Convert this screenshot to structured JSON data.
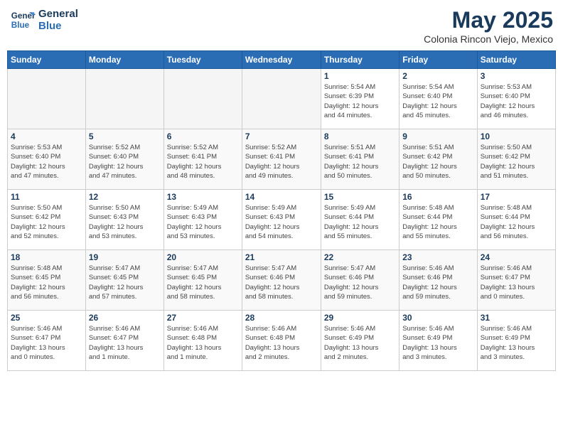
{
  "header": {
    "logo_line1": "General",
    "logo_line2": "Blue",
    "month_year": "May 2025",
    "location": "Colonia Rincon Viejo, Mexico"
  },
  "days_of_week": [
    "Sunday",
    "Monday",
    "Tuesday",
    "Wednesday",
    "Thursday",
    "Friday",
    "Saturday"
  ],
  "weeks": [
    [
      {
        "day": "",
        "info": ""
      },
      {
        "day": "",
        "info": ""
      },
      {
        "day": "",
        "info": ""
      },
      {
        "day": "",
        "info": ""
      },
      {
        "day": "1",
        "info": "Sunrise: 5:54 AM\nSunset: 6:39 PM\nDaylight: 12 hours\nand 44 minutes."
      },
      {
        "day": "2",
        "info": "Sunrise: 5:54 AM\nSunset: 6:40 PM\nDaylight: 12 hours\nand 45 minutes."
      },
      {
        "day": "3",
        "info": "Sunrise: 5:53 AM\nSunset: 6:40 PM\nDaylight: 12 hours\nand 46 minutes."
      }
    ],
    [
      {
        "day": "4",
        "info": "Sunrise: 5:53 AM\nSunset: 6:40 PM\nDaylight: 12 hours\nand 47 minutes."
      },
      {
        "day": "5",
        "info": "Sunrise: 5:52 AM\nSunset: 6:40 PM\nDaylight: 12 hours\nand 47 minutes."
      },
      {
        "day": "6",
        "info": "Sunrise: 5:52 AM\nSunset: 6:41 PM\nDaylight: 12 hours\nand 48 minutes."
      },
      {
        "day": "7",
        "info": "Sunrise: 5:52 AM\nSunset: 6:41 PM\nDaylight: 12 hours\nand 49 minutes."
      },
      {
        "day": "8",
        "info": "Sunrise: 5:51 AM\nSunset: 6:41 PM\nDaylight: 12 hours\nand 50 minutes."
      },
      {
        "day": "9",
        "info": "Sunrise: 5:51 AM\nSunset: 6:42 PM\nDaylight: 12 hours\nand 50 minutes."
      },
      {
        "day": "10",
        "info": "Sunrise: 5:50 AM\nSunset: 6:42 PM\nDaylight: 12 hours\nand 51 minutes."
      }
    ],
    [
      {
        "day": "11",
        "info": "Sunrise: 5:50 AM\nSunset: 6:42 PM\nDaylight: 12 hours\nand 52 minutes."
      },
      {
        "day": "12",
        "info": "Sunrise: 5:50 AM\nSunset: 6:43 PM\nDaylight: 12 hours\nand 53 minutes."
      },
      {
        "day": "13",
        "info": "Sunrise: 5:49 AM\nSunset: 6:43 PM\nDaylight: 12 hours\nand 53 minutes."
      },
      {
        "day": "14",
        "info": "Sunrise: 5:49 AM\nSunset: 6:43 PM\nDaylight: 12 hours\nand 54 minutes."
      },
      {
        "day": "15",
        "info": "Sunrise: 5:49 AM\nSunset: 6:44 PM\nDaylight: 12 hours\nand 55 minutes."
      },
      {
        "day": "16",
        "info": "Sunrise: 5:48 AM\nSunset: 6:44 PM\nDaylight: 12 hours\nand 55 minutes."
      },
      {
        "day": "17",
        "info": "Sunrise: 5:48 AM\nSunset: 6:44 PM\nDaylight: 12 hours\nand 56 minutes."
      }
    ],
    [
      {
        "day": "18",
        "info": "Sunrise: 5:48 AM\nSunset: 6:45 PM\nDaylight: 12 hours\nand 56 minutes."
      },
      {
        "day": "19",
        "info": "Sunrise: 5:47 AM\nSunset: 6:45 PM\nDaylight: 12 hours\nand 57 minutes."
      },
      {
        "day": "20",
        "info": "Sunrise: 5:47 AM\nSunset: 6:45 PM\nDaylight: 12 hours\nand 58 minutes."
      },
      {
        "day": "21",
        "info": "Sunrise: 5:47 AM\nSunset: 6:46 PM\nDaylight: 12 hours\nand 58 minutes."
      },
      {
        "day": "22",
        "info": "Sunrise: 5:47 AM\nSunset: 6:46 PM\nDaylight: 12 hours\nand 59 minutes."
      },
      {
        "day": "23",
        "info": "Sunrise: 5:46 AM\nSunset: 6:46 PM\nDaylight: 12 hours\nand 59 minutes."
      },
      {
        "day": "24",
        "info": "Sunrise: 5:46 AM\nSunset: 6:47 PM\nDaylight: 13 hours\nand 0 minutes."
      }
    ],
    [
      {
        "day": "25",
        "info": "Sunrise: 5:46 AM\nSunset: 6:47 PM\nDaylight: 13 hours\nand 0 minutes."
      },
      {
        "day": "26",
        "info": "Sunrise: 5:46 AM\nSunset: 6:47 PM\nDaylight: 13 hours\nand 1 minute."
      },
      {
        "day": "27",
        "info": "Sunrise: 5:46 AM\nSunset: 6:48 PM\nDaylight: 13 hours\nand 1 minute."
      },
      {
        "day": "28",
        "info": "Sunrise: 5:46 AM\nSunset: 6:48 PM\nDaylight: 13 hours\nand 2 minutes."
      },
      {
        "day": "29",
        "info": "Sunrise: 5:46 AM\nSunset: 6:49 PM\nDaylight: 13 hours\nand 2 minutes."
      },
      {
        "day": "30",
        "info": "Sunrise: 5:46 AM\nSunset: 6:49 PM\nDaylight: 13 hours\nand 3 minutes."
      },
      {
        "day": "31",
        "info": "Sunrise: 5:46 AM\nSunset: 6:49 PM\nDaylight: 13 hours\nand 3 minutes."
      }
    ]
  ]
}
